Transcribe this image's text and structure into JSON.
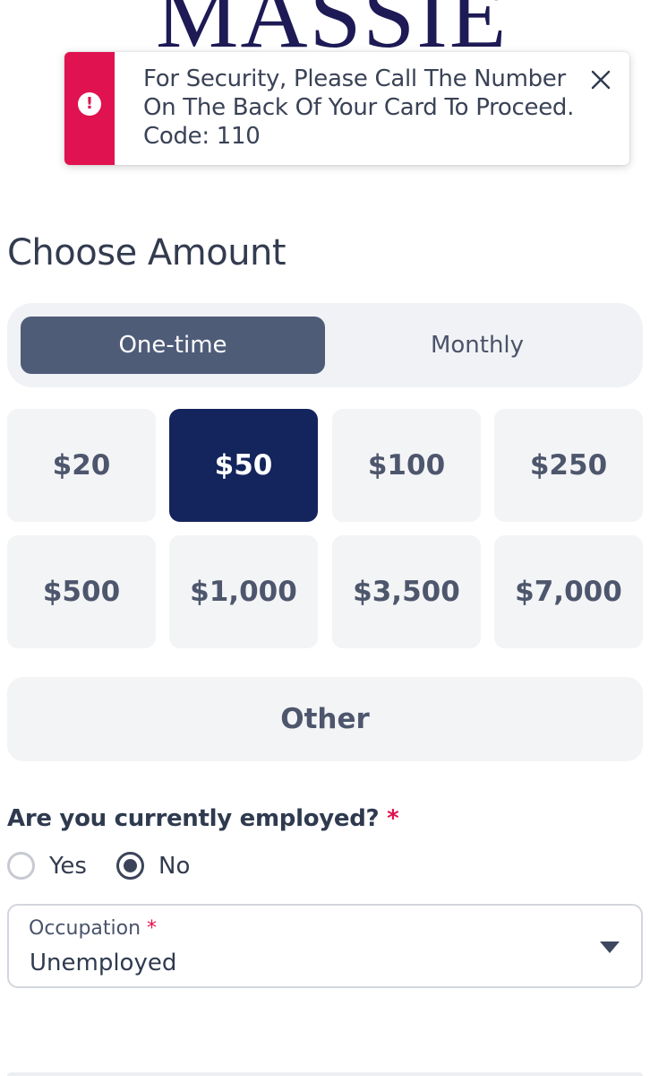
{
  "header": {
    "logo_text": "MASSIE"
  },
  "alert": {
    "icon": "exclamation-icon",
    "message": "For Security, Please Call The Number On The Back Of Your Card To Proceed. Code: 110",
    "close_icon": "close-icon",
    "accent_color": "#e0124f"
  },
  "donation": {
    "heading": "Choose Amount",
    "frequency": {
      "options": [
        "One-time",
        "Monthly"
      ],
      "selected": "One-time"
    },
    "amounts": [
      "$20",
      "$50",
      "$100",
      "$250",
      "$500",
      "$1,000",
      "$3,500",
      "$7,000"
    ],
    "selected_amount": "$50",
    "other_label": "Other",
    "selected_color": "#14245c",
    "toggle_active_color": "#4f5c78"
  },
  "employment": {
    "question": "Are you currently employed?",
    "required_mark": "*",
    "options": [
      "Yes",
      "No"
    ],
    "selected": "No"
  },
  "occupation": {
    "label": "Occupation",
    "required_mark": "*",
    "value": "Unemployed",
    "dropdown_icon": "caret-down-icon"
  }
}
